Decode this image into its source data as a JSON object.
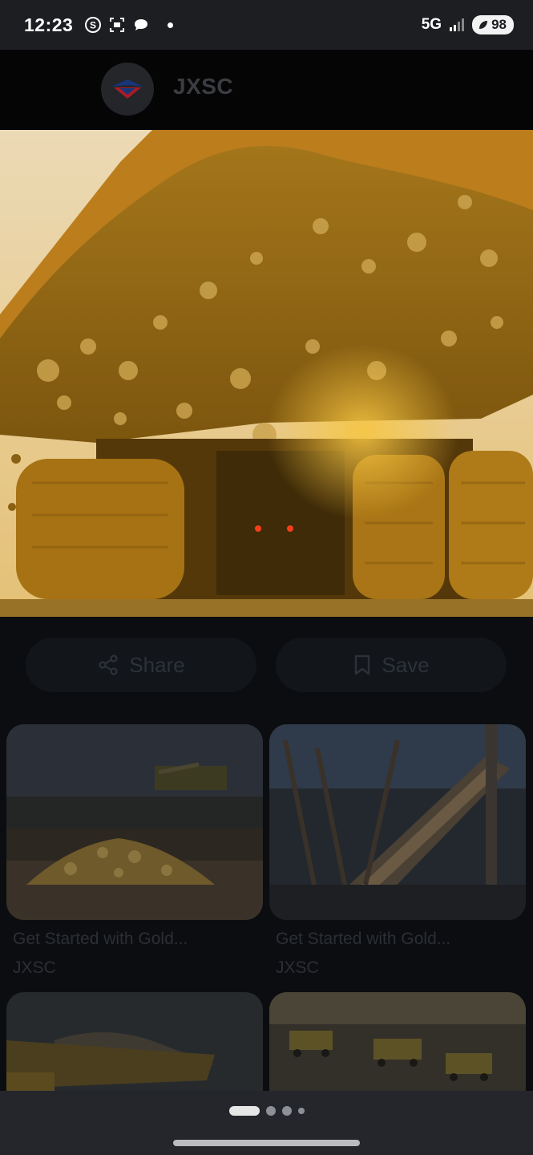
{
  "status_bar": {
    "time": "12:23",
    "network": "5G",
    "battery": "98"
  },
  "header": {
    "brand_name": "JXSC"
  },
  "actions": {
    "share_label": "Share",
    "save_label": "Save"
  },
  "results": [
    {
      "title": "Get Started with Gold...",
      "source": "JXSC"
    },
    {
      "title": "Get Started with Gold...",
      "source": "JXSC"
    },
    {
      "title": "",
      "source": ""
    },
    {
      "title": "",
      "source": ""
    }
  ],
  "pager": {
    "pages": 4,
    "active": 1
  },
  "colors": {
    "accent_gold": "#c8901c",
    "background": "#0c0d10"
  }
}
